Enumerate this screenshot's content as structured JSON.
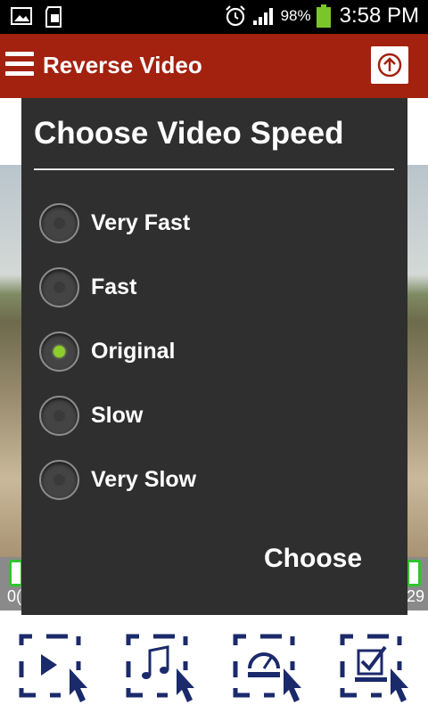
{
  "status_bar": {
    "battery_percent": "98%",
    "time": "3:58 PM",
    "icons": [
      "image-icon",
      "sd-card-icon",
      "alarm-icon",
      "signal-icon",
      "battery-icon"
    ]
  },
  "app_bar": {
    "title": "Reverse Video",
    "color": "#a3210f"
  },
  "timeline": {
    "start_time": "0(",
    "end_time": "29"
  },
  "dialog": {
    "title": "Choose Video Speed",
    "options": [
      {
        "label": "Very Fast",
        "selected": false
      },
      {
        "label": "Fast",
        "selected": false
      },
      {
        "label": "Original",
        "selected": true
      },
      {
        "label": "Slow",
        "selected": false
      },
      {
        "label": "Very Slow",
        "selected": false
      }
    ],
    "confirm_label": "Choose"
  },
  "bottom_actions": [
    "play-video-action",
    "music-action",
    "speed-action",
    "save-action"
  ],
  "colors": {
    "accent_navy": "#1b2a6b",
    "radio_selected": "#8dce2b",
    "dialog_bg": "#2f2f2f"
  }
}
